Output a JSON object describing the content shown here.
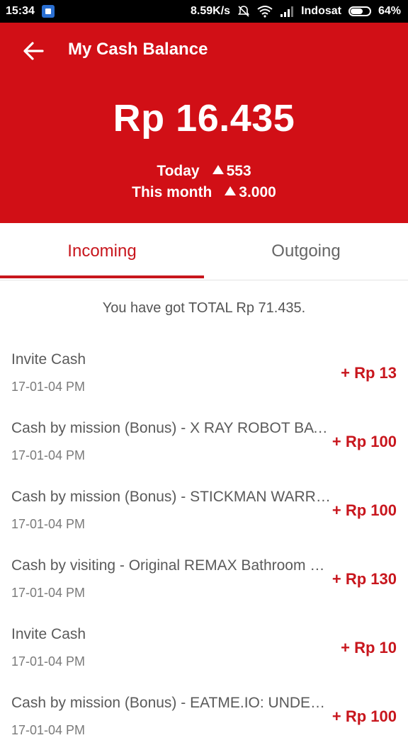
{
  "status_bar": {
    "time": "15:34",
    "speed": "8.59K/s",
    "carrier": "Indosat",
    "battery": "64%"
  },
  "header": {
    "title": "My Cash Balance",
    "balance": "Rp 16.435",
    "today_label": "Today",
    "today_value": "553",
    "month_label": "This month",
    "month_value": "3.000"
  },
  "tabs": {
    "incoming": "Incoming",
    "outgoing": "Outgoing",
    "active": "incoming"
  },
  "summary": "You have got TOTAL Rp 71.435.",
  "transactions": [
    {
      "title": "Invite Cash",
      "date": "17-01-04 PM",
      "amount": "+ Rp 13"
    },
    {
      "title": "Cash by mission (Bonus) - X RAY ROBOT BATTLE",
      "date": "17-01-04 PM",
      "amount": "+ Rp 100"
    },
    {
      "title": "Cash by mission (Bonus) - STICKMAN WARRIORS",
      "date": "17-01-04 PM",
      "amount": "+ Rp 100"
    },
    {
      "title": "Cash by visiting - Original REMAX Bathroom Speaker",
      "date": "17-01-04 PM",
      "amount": "+ Rp 130"
    },
    {
      "title": "Invite Cash",
      "date": "17-01-04 PM",
      "amount": "+ Rp 10"
    },
    {
      "title": "Cash by mission (Bonus) - EATME.IO: UNDERSEA",
      "date": "17-01-04 PM",
      "amount": "+ Rp 100"
    }
  ],
  "colors": {
    "brand_red": "#d10f16",
    "accent_red": "#c8161d"
  }
}
